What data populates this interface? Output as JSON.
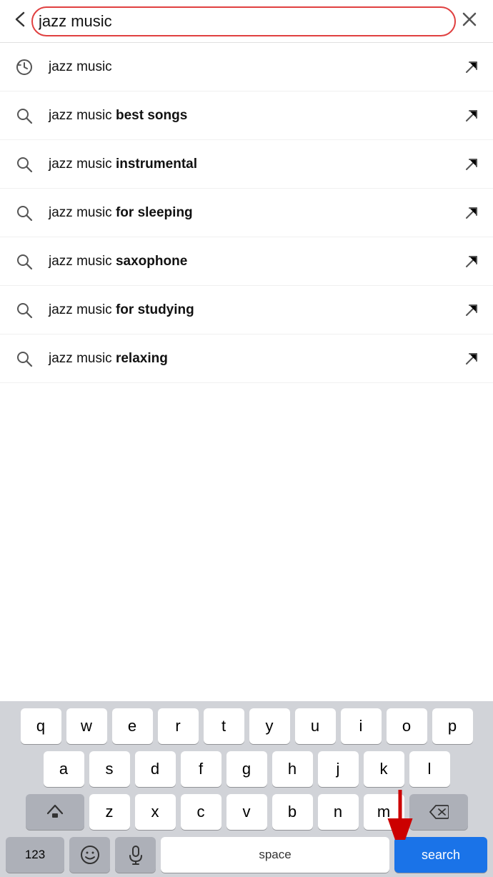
{
  "searchBar": {
    "backLabel": "‹",
    "queryValue": "jazz music",
    "closeLabel": "×"
  },
  "suggestions": [
    {
      "id": "s1",
      "iconType": "history",
      "text": "jazz music",
      "boldPart": ""
    },
    {
      "id": "s2",
      "iconType": "search",
      "text": "jazz music ",
      "boldPart": "best songs"
    },
    {
      "id": "s3",
      "iconType": "search",
      "text": "jazz music ",
      "boldPart": "instrumental"
    },
    {
      "id": "s4",
      "iconType": "search",
      "text": "jazz music ",
      "boldPart": "for sleeping"
    },
    {
      "id": "s5",
      "iconType": "search",
      "text": "jazz music ",
      "boldPart": "saxophone"
    },
    {
      "id": "s6",
      "iconType": "search",
      "text": "jazz music ",
      "boldPart": "for studying"
    },
    {
      "id": "s7",
      "iconType": "search",
      "text": "jazz music ",
      "boldPart": "relaxing"
    }
  ],
  "keyboard": {
    "rows": [
      [
        "q",
        "w",
        "e",
        "r",
        "t",
        "y",
        "u",
        "i",
        "o",
        "p"
      ],
      [
        "a",
        "s",
        "d",
        "f",
        "g",
        "h",
        "j",
        "k",
        "l"
      ],
      [
        "z",
        "x",
        "c",
        "v",
        "b",
        "n",
        "m"
      ]
    ],
    "spaceLabel": "space",
    "searchLabel": "search",
    "numberLabel": "123"
  }
}
